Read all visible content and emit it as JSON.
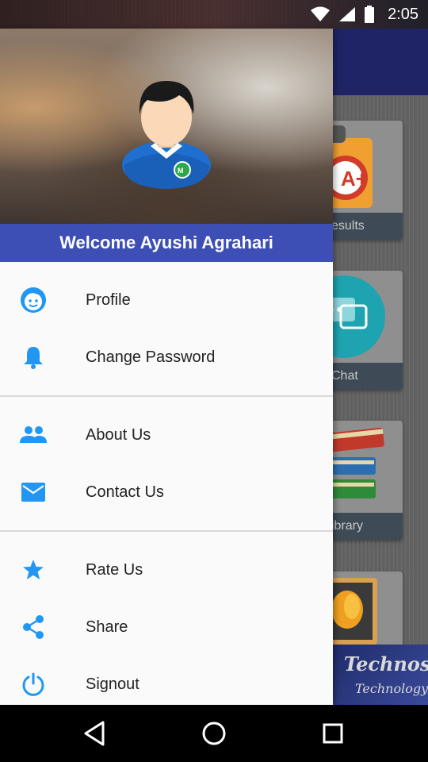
{
  "status_bar": {
    "time": "2:05",
    "icons": [
      "wifi-icon",
      "cell-signal-icon",
      "battery-icon"
    ]
  },
  "background_app": {
    "tiles": [
      {
        "label": "esults",
        "icon": "results-clipboard-icon"
      },
      {
        "label": "Chat",
        "icon": "chat-bubble-icon"
      },
      {
        "label": "ibrary",
        "icon": "books-icon"
      },
      {
        "label": "",
        "icon": "flower-photo-icon"
      }
    ],
    "brand": {
      "line1": "Technosoft",
      "line2": "Technology"
    }
  },
  "drawer": {
    "welcome": "Welcome Ayushi Agrahari",
    "sections": [
      [
        {
          "label": "Profile",
          "icon": "face-icon"
        },
        {
          "label": "Change Password",
          "icon": "bell-icon"
        }
      ],
      [
        {
          "label": "About Us",
          "icon": "people-icon"
        },
        {
          "label": "Contact Us",
          "icon": "mail-icon"
        }
      ],
      [
        {
          "label": "Rate Us",
          "icon": "star-icon"
        },
        {
          "label": "Share",
          "icon": "share-icon"
        },
        {
          "label": "Signout",
          "icon": "power-icon"
        }
      ]
    ]
  },
  "nav_bar": {
    "buttons": [
      "back-icon",
      "home-icon",
      "recents-icon"
    ]
  },
  "colors": {
    "accent": "#2196f3",
    "header_bar": "#3d4fb5",
    "app_bar": "#1f2466"
  }
}
